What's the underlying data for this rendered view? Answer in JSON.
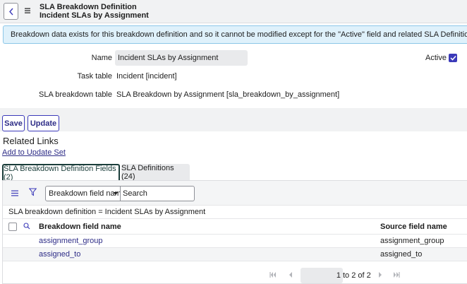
{
  "header": {
    "title": "SLA Breakdown Definition",
    "subtitle": "Incident SLAs by Assignment"
  },
  "banner": {
    "text": "Breakdown data exists for this breakdown definition and so it cannot be modified except for the \"Active\" field and related SLA Definitions"
  },
  "form": {
    "name_label": "Name",
    "name_value": "Incident SLAs by Assignment",
    "task_table_label": "Task table",
    "task_table_value": "Incident [incident]",
    "breakdown_table_label": "SLA breakdown table",
    "breakdown_table_value": "SLA Breakdown by Assignment [sla_breakdown_by_assignment]",
    "active_label": "Active",
    "active_checked": true
  },
  "buttons": {
    "save": "Save",
    "update": "Update"
  },
  "related_links": {
    "title": "Related Links",
    "add_to_update_set": "Add to Update Set"
  },
  "tabs": [
    {
      "label": "SLA Breakdown Definition Fields (2)",
      "active": true
    },
    {
      "label": "SLA Definitions (24)",
      "active": false
    }
  ],
  "list": {
    "field_select": "Breakdown field name",
    "search_placeholder": "Search",
    "breadcrumb": "SLA breakdown definition = Incident SLAs by Assignment",
    "columns": [
      "Breakdown field name",
      "Source field name"
    ],
    "rows": [
      {
        "breakdown_field": "assignment_group",
        "source_field": "assignment_group"
      },
      {
        "breakdown_field": "assigned_to",
        "source_field": "assigned_to"
      }
    ],
    "pager": {
      "current": "1",
      "of_text": "to 2 of 2"
    }
  },
  "colors": {
    "accent": "#3b3ab9",
    "link": "#2e2d87",
    "banner_bg": "#dff1fb",
    "active_tab": "#1a3d3a"
  }
}
